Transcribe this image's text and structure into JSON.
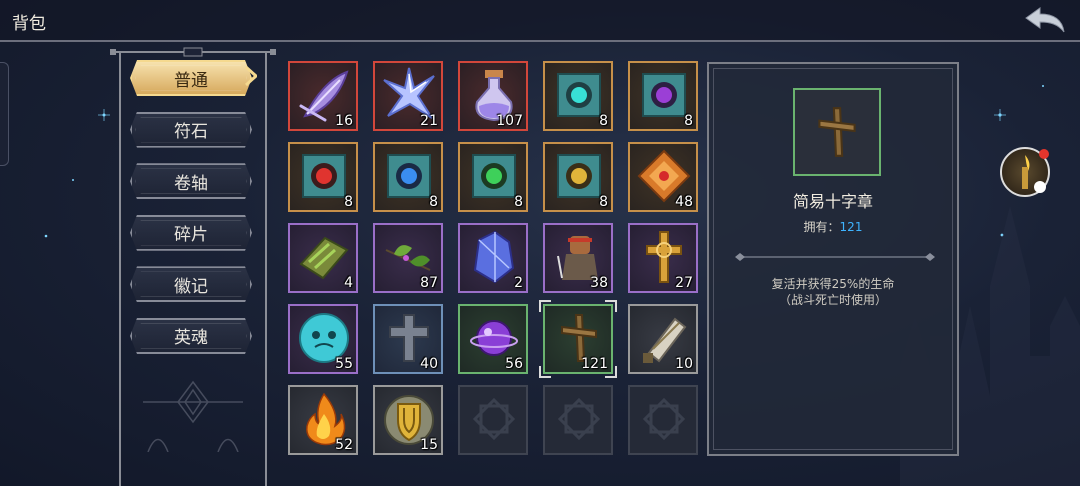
{
  "header": {
    "title": "背包"
  },
  "tabs": [
    {
      "label": "普通",
      "active": true
    },
    {
      "label": "符石",
      "active": false
    },
    {
      "label": "卷轴",
      "active": false
    },
    {
      "label": "碎片",
      "active": false
    },
    {
      "label": "徽记",
      "active": false
    },
    {
      "label": "英魂",
      "active": false
    }
  ],
  "items": [
    {
      "icon": "purple-feather-icon",
      "count": "16",
      "rarity": "red"
    },
    {
      "icon": "crystal-star-icon",
      "count": "21",
      "rarity": "red"
    },
    {
      "icon": "potion-flask-icon",
      "count": "107",
      "rarity": "red"
    },
    {
      "icon": "teal-rune-scroll-icon",
      "count": "8",
      "rarity": "gold"
    },
    {
      "icon": "purple-rune-scroll-icon",
      "count": "8",
      "rarity": "gold"
    },
    {
      "icon": "red-rune-scroll-icon",
      "count": "8",
      "rarity": "gold"
    },
    {
      "icon": "blue-rune-scroll-icon",
      "count": "8",
      "rarity": "gold"
    },
    {
      "icon": "green-rune-scroll-icon",
      "count": "8",
      "rarity": "gold"
    },
    {
      "icon": "gold-rune-scroll-icon",
      "count": "8",
      "rarity": "gold"
    },
    {
      "icon": "orange-emblem-icon",
      "count": "48",
      "rarity": "gold"
    },
    {
      "icon": "green-bundle-icon",
      "count": "4",
      "rarity": "purple"
    },
    {
      "icon": "leaf-sprig-icon",
      "count": "87",
      "rarity": "purple"
    },
    {
      "icon": "blue-crystal-icon",
      "count": "2",
      "rarity": "purple"
    },
    {
      "icon": "warrior-figure-icon",
      "count": "38",
      "rarity": "purple"
    },
    {
      "icon": "golden-cross-icon",
      "count": "27",
      "rarity": "purple"
    },
    {
      "icon": "cyan-skull-orb-icon",
      "count": "55",
      "rarity": "purple"
    },
    {
      "icon": "stone-cross-icon",
      "count": "40",
      "rarity": "blue"
    },
    {
      "icon": "purple-orb-icon",
      "count": "56",
      "rarity": "green"
    },
    {
      "icon": "wooden-cross-icon",
      "count": "121",
      "rarity": "green",
      "selected": true
    },
    {
      "icon": "scroll-bundle-icon",
      "count": "10",
      "rarity": "grey"
    },
    {
      "icon": "flame-icon",
      "count": "52",
      "rarity": "grey"
    },
    {
      "icon": "gold-shield-icon",
      "count": "15",
      "rarity": "grey"
    },
    {
      "icon": "empty-slot-icon",
      "count": "",
      "rarity": "empty"
    },
    {
      "icon": "empty-slot-icon",
      "count": "",
      "rarity": "empty"
    },
    {
      "icon": "empty-slot-icon",
      "count": "",
      "rarity": "empty"
    }
  ],
  "detail": {
    "icon": "wooden-cross-icon",
    "name": "简易十字章",
    "own_label": "拥有：",
    "own_value": "121",
    "desc_line1": "复活并获得25%的生命",
    "desc_line2": "（战斗死亡时使用）"
  },
  "colors": {
    "gold_tab": "#d6a95d",
    "count_blue": "#3eb3ff",
    "rarity_red": "#d2473b",
    "rarity_gold": "#c6904a",
    "rarity_purple": "#9a6fc8",
    "rarity_blue": "#6e90b8",
    "rarity_green": "#6ab36f",
    "rarity_grey": "#9a9a9a",
    "notification_red": "#e3352c"
  }
}
